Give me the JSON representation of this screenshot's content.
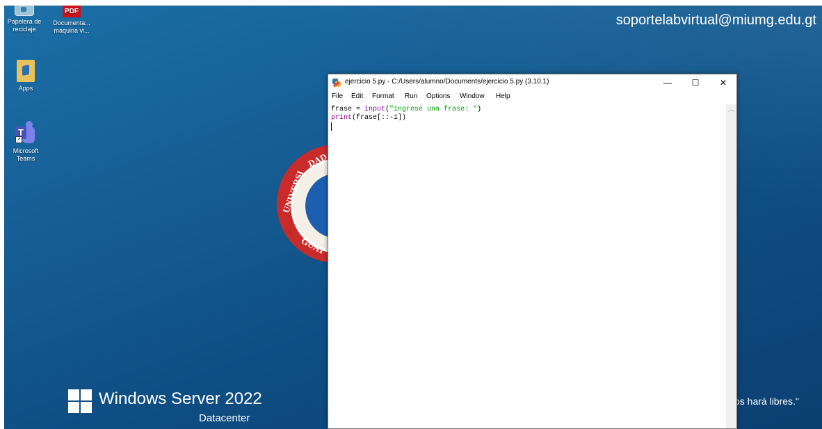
{
  "desktop": {
    "email": "soportelabvirtual@miumg.edu.gt",
    "icons": [
      {
        "label_line1": "Papelera de",
        "label_line2": "reciclaje",
        "icon": "recycle-bin-icon"
      },
      {
        "label_line1": "Documenta...",
        "label_line2": "maquina vi...",
        "icon": "pdf-icon",
        "badge": "PDF"
      },
      {
        "label_line1": "Apps",
        "label_line2": "",
        "icon": "apps-folder-icon"
      },
      {
        "label_line1": "Microsoft",
        "label_line2": "Teams",
        "icon": "teams-icon",
        "badge": "T"
      }
    ],
    "seal_text": {
      "arc_top": "DAD N",
      "arc_left": "UNIVERSI",
      "arc_bottom": "GUAT"
    },
    "os_title": "Windows Server 2022",
    "os_edition": "Datacenter",
    "motto": "os hará libres.\""
  },
  "window": {
    "title": "ejercicio 5.py - C:/Users/alumno/Documents/ejercicio 5.py (3.10.1)",
    "controls": {
      "minimize": "—",
      "maximize": "☐",
      "close": "✕"
    },
    "menu": [
      "File",
      "Edit",
      "Format",
      "Run",
      "Options",
      "Window",
      "Help"
    ],
    "code": {
      "line1": {
        "a": "frase = ",
        "kw": "input",
        "b": "(",
        "str": "\"ingrese una frase: \"",
        "c": ")"
      },
      "line2": {
        "kw": "print",
        "b": "(frase[::-1])"
      }
    }
  },
  "colors": {
    "keyword": "#900090",
    "string": "#00a000",
    "desktop_bg": "#155d93"
  }
}
